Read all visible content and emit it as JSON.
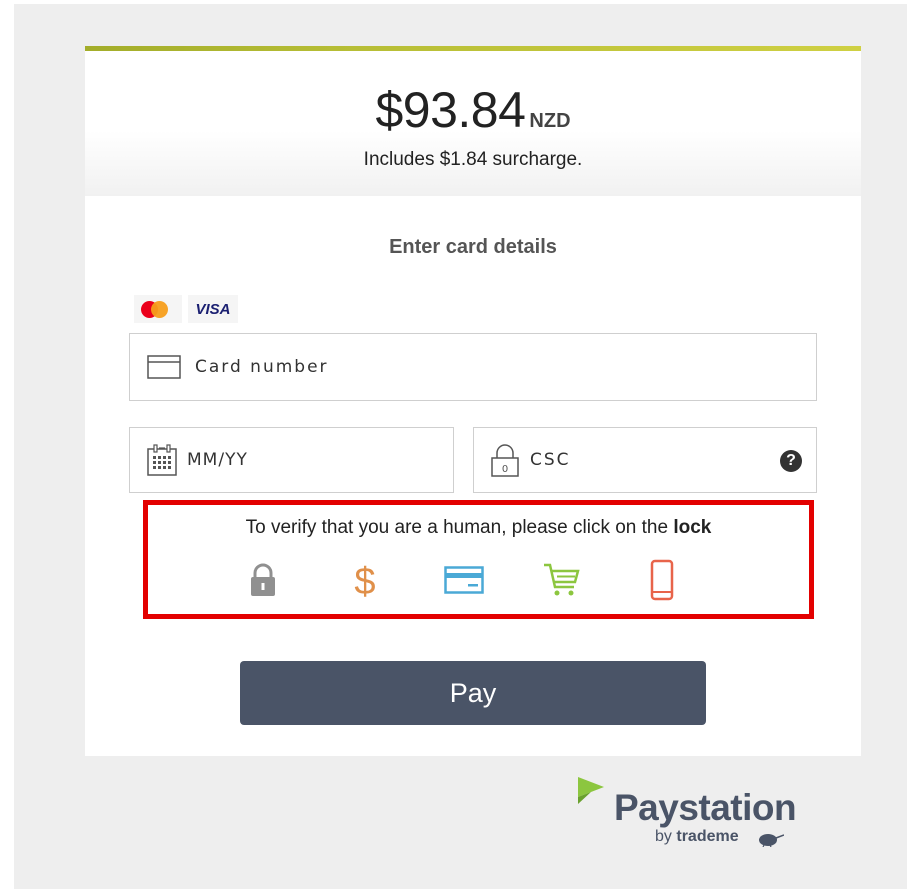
{
  "payment": {
    "amount": "$93.84",
    "currency": "NZD",
    "surcharge_text": "Includes $1.84 surcharge."
  },
  "form": {
    "title": "Enter card details",
    "card_brands": [
      "mastercard",
      "VISA"
    ],
    "card_number_placeholder": "Card number",
    "expiry_placeholder": "MM/YY",
    "csc_placeholder": "CSC",
    "help_label": "?"
  },
  "captcha": {
    "text_prefix": "To verify that you are a human, please click on the",
    "text_bold": "lock",
    "icons": [
      {
        "name": "lock-icon",
        "color": "#909090"
      },
      {
        "name": "dollar-icon",
        "color": "#e0904a"
      },
      {
        "name": "credit-card-icon",
        "color": "#4aa9d6"
      },
      {
        "name": "shopping-cart-icon",
        "color": "#8cc63f"
      },
      {
        "name": "mobile-phone-icon",
        "color": "#e8644a"
      }
    ],
    "border_color": "#e30000"
  },
  "pay_button": {
    "label": "Pay",
    "color": "#4a5467"
  },
  "footer": {
    "brand": "Paystation",
    "sub_prefix": "by",
    "sub_brand": "trademe",
    "brand_color": "#4a5467",
    "accent_color": "#8cc63f"
  }
}
